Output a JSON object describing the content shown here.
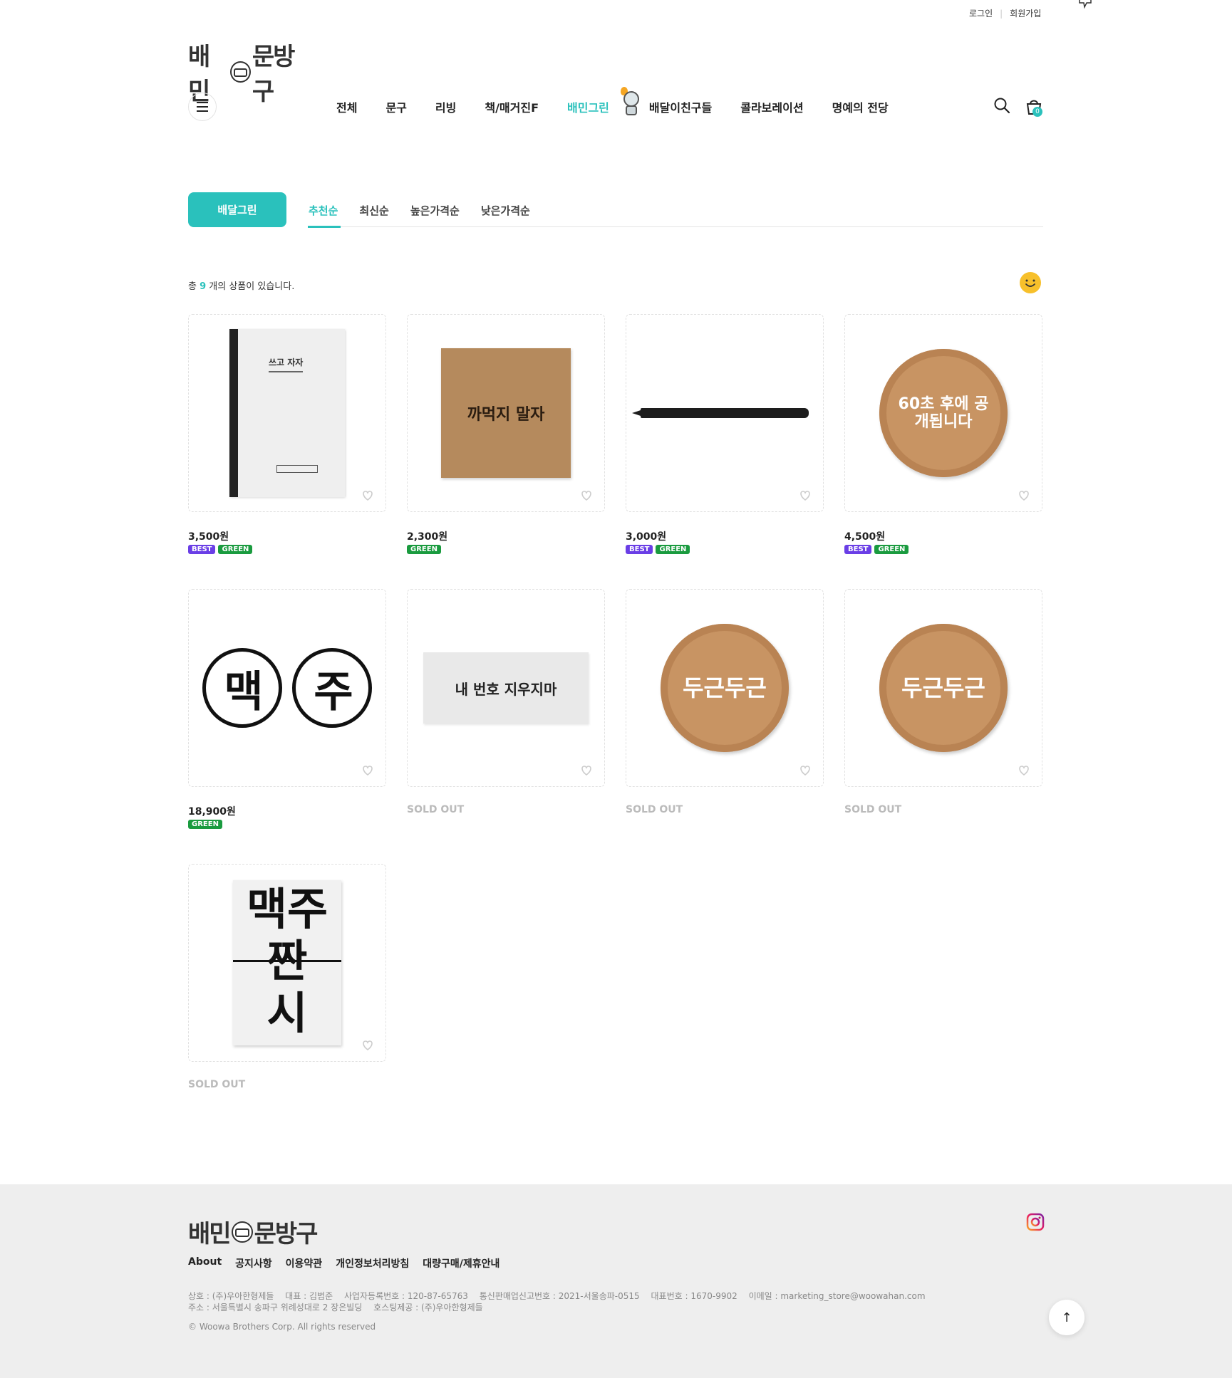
{
  "header": {
    "login": "로그인",
    "signup": "회원가입",
    "logo_left": "배민",
    "logo_right": "문방구",
    "cart_count": "0",
    "nav": [
      "전체",
      "문구",
      "리빙",
      "책/매거진F",
      "배민그린",
      "배달이친구들",
      "콜라보레이션",
      "명예의 전당"
    ],
    "active_nav": "배민그린"
  },
  "category": {
    "title": "배달그린",
    "sort_tabs": [
      "추천순",
      "최신순",
      "높은가격순",
      "낮은가격순"
    ],
    "active_sort": "추천순"
  },
  "summary": {
    "prefix": "총",
    "count": "9",
    "suffix": "개의 상품이 있습니다."
  },
  "products": [
    {
      "price": "3,500원",
      "badges": [
        "BEST",
        "GREEN"
      ],
      "image_text": "쓰고 자자"
    },
    {
      "price": "2,300원",
      "badges": [
        "GREEN"
      ],
      "image_text": "까먹지 말자"
    },
    {
      "price": "3,000원",
      "badges": [
        "BEST",
        "GREEN"
      ],
      "image_text": ""
    },
    {
      "price": "4,500원",
      "badges": [
        "BEST",
        "GREEN"
      ],
      "image_text": "60초 후에 공개됩니다"
    },
    {
      "price": "18,900원",
      "badges": [
        "GREEN"
      ],
      "image_text": "맥주"
    },
    {
      "status": "SOLD OUT",
      "image_text": "내 번호 지우지마"
    },
    {
      "status": "SOLD OUT",
      "image_text": "두근두근"
    },
    {
      "status": "SOLD OUT",
      "image_text": "두근두근"
    },
    {
      "status": "SOLD OUT",
      "image_text": "맥주 짠 시"
    }
  ],
  "badge_colors": {
    "BEST": "#6a3ee6",
    "GREEN": "#1a9b3f"
  },
  "accent_color": "#2ac1bc",
  "footer": {
    "links": [
      "About",
      "공지사항",
      "이용약관",
      "개인정보처리방침",
      "대량구매/제휴안내"
    ],
    "info_row1": [
      "상호 : (주)우아한형제들",
      "대표 : 김범준",
      "사업자등록번호 : 120-87-65763",
      "통신판매업신고번호 : 2021-서울송파-0515",
      "대표번호 : 1670-9902",
      "이메일 : marketing_store@woowahan.com"
    ],
    "info_row2": [
      "주소 : 서울특별시 송파구 위례성대로 2 장은빌딩",
      "호스팅제공 : (주)우아한형제들"
    ],
    "copyright": "© Woowa Brothers Corp. All rights reserved"
  },
  "icons": {
    "search": "search-icon",
    "cart": "cart-icon",
    "heart": "heart-icon",
    "instagram": "instagram-icon",
    "top": "arrow-up-icon"
  }
}
